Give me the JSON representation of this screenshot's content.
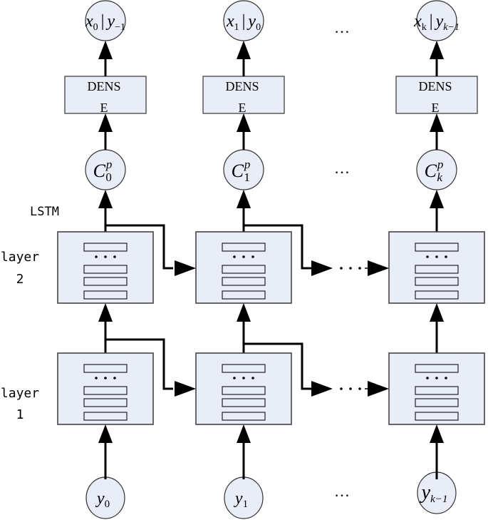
{
  "diagram": {
    "type": "stacked LSTM sequence diagram",
    "side_labels": {
      "lstm": "LSTM",
      "layer2_line1": "layer",
      "layer2_line2": "2",
      "layer1_line1": "layer",
      "layer1_line2": "1"
    },
    "dense_label_line1": "DENS",
    "dense_label_line2": "E",
    "ellipsis": "…",
    "columns": [
      {
        "output": {
          "x": "x",
          "x_sub": "0",
          "sep": "|",
          "y": "y",
          "y_sub": "−1"
        },
        "context": {
          "c": "C",
          "sup": "p",
          "sub": "0"
        },
        "input": {
          "y": "y",
          "sub": "0"
        }
      },
      {
        "output": {
          "x": "x",
          "x_sub": "1",
          "sep": "|",
          "y": "y",
          "y_sub": "0"
        },
        "context": {
          "c": "C",
          "sup": "p",
          "sub": "1"
        },
        "input": {
          "y": "y",
          "sub": "1"
        }
      },
      {
        "output": {
          "x": "x",
          "x_sub": "k",
          "sep": "|",
          "y": "y",
          "y_sub": "k−1"
        },
        "context": {
          "c": "C",
          "sup": "p",
          "sub": "k"
        },
        "input": {
          "y": "y",
          "sub": "k−1"
        }
      }
    ],
    "colors": {
      "node_fill": "#e8edf8",
      "stroke": "#000000"
    }
  }
}
